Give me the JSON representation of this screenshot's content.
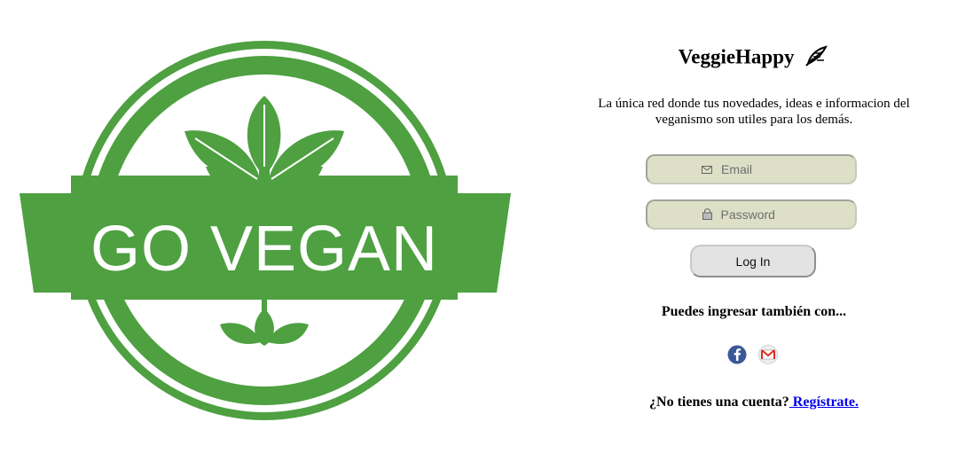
{
  "logo": {
    "text": "GO VEGAN",
    "color": "#4ea041"
  },
  "brand": {
    "name": "VeggieHappy",
    "icon": "leaf-icon"
  },
  "description": "La única red donde tus novedades, ideas e informacion del veganismo son utiles para los demás.",
  "form": {
    "email_placeholder": "Email",
    "email_icon": "envelope-icon",
    "password_placeholder": "Password",
    "password_icon": "lock-icon",
    "login_label": "Log In",
    "field_color": "#dde0c7"
  },
  "alt_login": {
    "text": "Puedes ingresar también con...",
    "providers": [
      "facebook-icon",
      "gmail-icon"
    ]
  },
  "signup": {
    "prompt": "¿No tienes una cuenta?",
    "link": " Regístrate."
  }
}
